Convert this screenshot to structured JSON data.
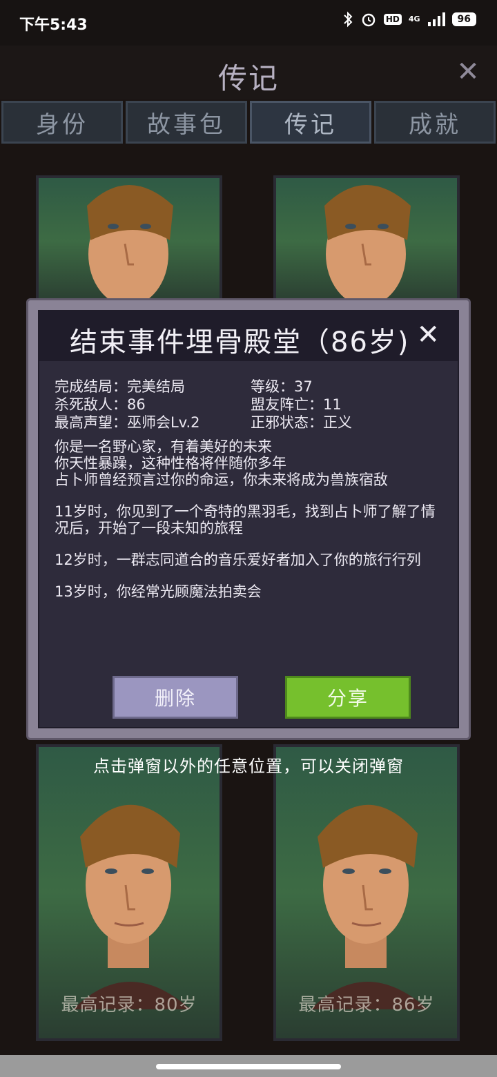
{
  "status_bar": {
    "time": "下午5:43",
    "network": "4G",
    "hd": "HD",
    "battery": "96"
  },
  "header": {
    "title": "传记"
  },
  "tabs": [
    {
      "label": "身份"
    },
    {
      "label": "故事包"
    },
    {
      "label": "传记"
    },
    {
      "label": "成就"
    }
  ],
  "cards": [
    {
      "caption": ""
    },
    {
      "caption": ""
    },
    {
      "caption": "最高记录：80岁"
    },
    {
      "caption": "最高记录：86岁"
    }
  ],
  "modal": {
    "title": "结束事件埋骨殿堂（86岁)",
    "stats": [
      {
        "label": "完成结局：完美结局"
      },
      {
        "label": "等级：37"
      },
      {
        "label": "杀死敌人：86"
      },
      {
        "label": "盟友阵亡：11"
      },
      {
        "label": "最高声望：巫师会Lv.2"
      },
      {
        "label": "正邪状态：正义"
      }
    ],
    "story": [
      "你是一名野心家，有着美好的未来\n你天性暴躁，这种性格将伴随你多年\n占卜师曾经预言过你的命运，你未来将成为兽族宿敌",
      "11岁时，你见到了一个奇特的黑羽毛，找到占卜师了解了情况后，开始了一段未知的旅程",
      "12岁时，一群志同道合的音乐爱好者加入了你的旅行行列",
      "13岁时，你经常光顾魔法拍卖会"
    ],
    "delete_label": "删除",
    "share_label": "分享"
  },
  "hint": "点击弹窗以外的任意位置，可以关闭弹窗",
  "colors": {
    "share": "#76c02d",
    "delete": "#9b96c0",
    "panel": "#2e2b3b"
  }
}
